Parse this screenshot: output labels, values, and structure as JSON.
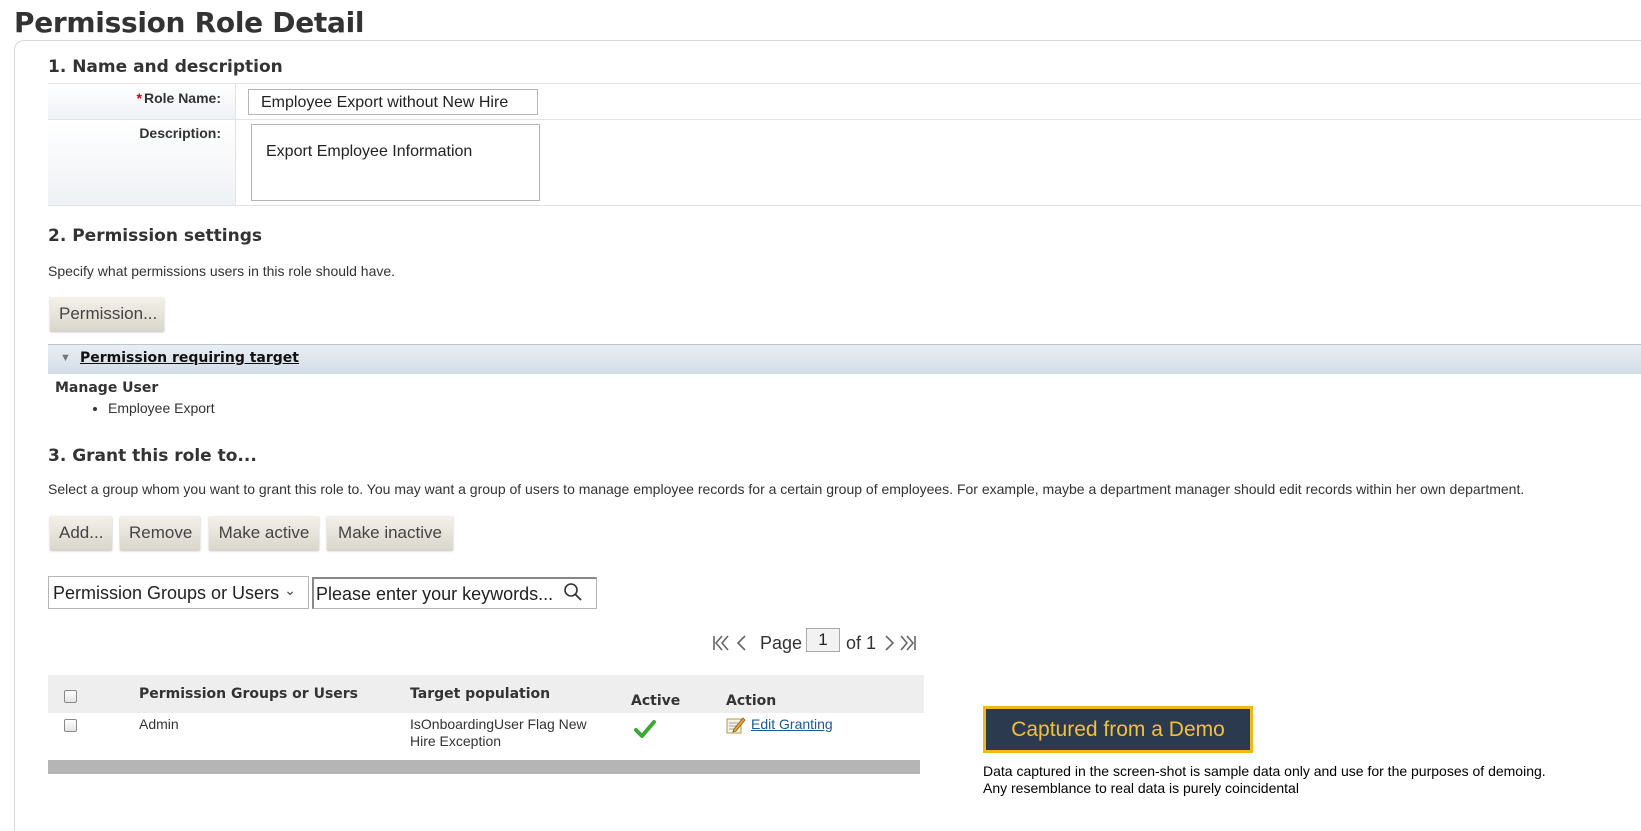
{
  "page": {
    "title": "Permission Role Detail"
  },
  "section1": {
    "title": "1. Name and description",
    "role_name_label": "Role Name:",
    "role_name_value": "Employee Export without New Hire",
    "description_label": "Description:",
    "description_value": "Export Employee Information"
  },
  "section2": {
    "title": "2. Permission settings",
    "help": "Specify what permissions users in this role should have.",
    "permission_button": "Permission...",
    "bar_link": "Permission requiring target",
    "category": "Manage User",
    "items": [
      "Employee Export"
    ]
  },
  "section3": {
    "title": "3. Grant this role to...",
    "help": "Select a group whom you want to grant this role to. You may want a group of users to manage employee records for a certain group of employees. For example, maybe a department manager should edit records within her own department.",
    "buttons": {
      "add": "Add...",
      "remove": "Remove",
      "make_active": "Make active",
      "make_inactive": "Make inactive"
    },
    "filter_select": "Permission Groups or Users",
    "search_placeholder": "Please enter your keywords...",
    "pager": {
      "page_label": "Page",
      "current": "1",
      "of_label": "of 1"
    },
    "table": {
      "headers": [
        "Permission Groups or Users",
        "Target population",
        "Active",
        "Action"
      ],
      "rows": [
        {
          "group": "Admin",
          "target": "IsOnboardingUser Flag New Hire Exception",
          "active": true,
          "action": "Edit Granting"
        }
      ]
    }
  },
  "demo": {
    "badge": "Captured from a Demo",
    "disclaimer_line1": "Data captured in the screen-shot is sample data only and use for the purposes of demoing.",
    "disclaimer_line2": "Any resemblance to real data is purely coincidental"
  },
  "colors": {
    "badge_bg": "#2c3a4f",
    "badge_border": "#f2b818",
    "link": "#1a5a96",
    "active_check": "#3aa935"
  }
}
